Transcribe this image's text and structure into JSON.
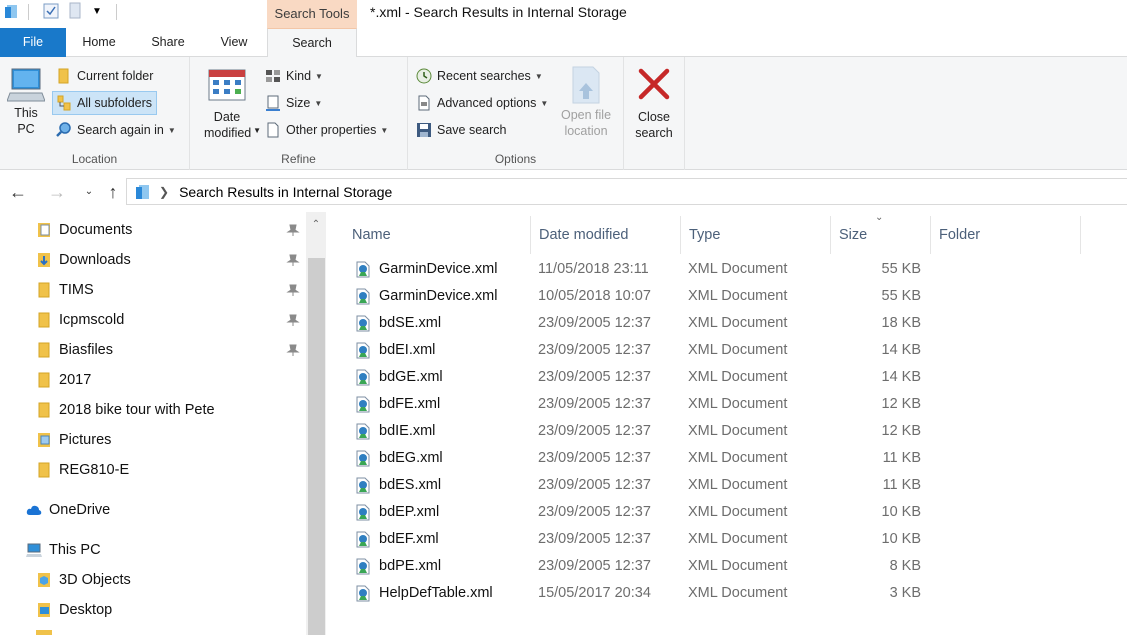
{
  "window": {
    "title": "*.xml - Search Results in Internal Storage",
    "contextual_tab_group": "Search Tools"
  },
  "tabs": {
    "file": "File",
    "home": "Home",
    "share": "Share",
    "view": "View",
    "search": "Search"
  },
  "ribbon": {
    "location": {
      "label": "Location",
      "this_pc": "This PC",
      "current_folder": "Current folder",
      "all_subfolders": "All subfolders",
      "search_again_in": "Search again in"
    },
    "refine": {
      "label": "Refine",
      "date_modified": "Date modified",
      "kind": "Kind",
      "size": "Size",
      "other_properties": "Other properties"
    },
    "options": {
      "label": "Options",
      "recent_searches": "Recent searches",
      "advanced_options": "Advanced options",
      "save_search": "Save search",
      "open_file_location": "Open file location"
    },
    "close": {
      "label": "Close search"
    }
  },
  "address": {
    "path": "Search Results in Internal Storage"
  },
  "navpane": {
    "quick_access": [
      "Documents",
      "Downloads",
      "TIMS",
      "Icpmscold",
      "Biasfiles",
      "2017",
      "2018 bike tour with Pete",
      "Pictures",
      "REG810-E"
    ],
    "onedrive": "OneDrive",
    "this_pc": "This PC",
    "this_pc_items": [
      "3D Objects",
      "Desktop"
    ]
  },
  "columns": {
    "name": "Name",
    "date": "Date modified",
    "type": "Type",
    "size": "Size",
    "folder": "Folder"
  },
  "files": [
    {
      "name": "GarminDevice.xml",
      "date": "11/05/2018 23:11",
      "type": "XML Document",
      "size": "55 KB"
    },
    {
      "name": "GarminDevice.xml",
      "date": "10/05/2018 10:07",
      "type": "XML Document",
      "size": "55 KB"
    },
    {
      "name": "bdSE.xml",
      "date": "23/09/2005 12:37",
      "type": "XML Document",
      "size": "18 KB"
    },
    {
      "name": "bdEI.xml",
      "date": "23/09/2005 12:37",
      "type": "XML Document",
      "size": "14 KB"
    },
    {
      "name": "bdGE.xml",
      "date": "23/09/2005 12:37",
      "type": "XML Document",
      "size": "14 KB"
    },
    {
      "name": "bdFE.xml",
      "date": "23/09/2005 12:37",
      "type": "XML Document",
      "size": "12 KB"
    },
    {
      "name": "bdIE.xml",
      "date": "23/09/2005 12:37",
      "type": "XML Document",
      "size": "12 KB"
    },
    {
      "name": "bdEG.xml",
      "date": "23/09/2005 12:37",
      "type": "XML Document",
      "size": "11 KB"
    },
    {
      "name": "bdES.xml",
      "date": "23/09/2005 12:37",
      "type": "XML Document",
      "size": "11 KB"
    },
    {
      "name": "bdEP.xml",
      "date": "23/09/2005 12:37",
      "type": "XML Document",
      "size": "10 KB"
    },
    {
      "name": "bdEF.xml",
      "date": "23/09/2005 12:37",
      "type": "XML Document",
      "size": "10 KB"
    },
    {
      "name": "bdPE.xml",
      "date": "23/09/2005 12:37",
      "type": "XML Document",
      "size": "8 KB"
    },
    {
      "name": "HelpDefTable.xml",
      "date": "15/05/2017 20:34",
      "type": "XML Document",
      "size": "3 KB"
    }
  ],
  "colors": {
    "file_tab": "#1979ca",
    "search_tools": "#f9d9c3",
    "folder": "#f0c24a",
    "selected": "#cce4f7"
  }
}
